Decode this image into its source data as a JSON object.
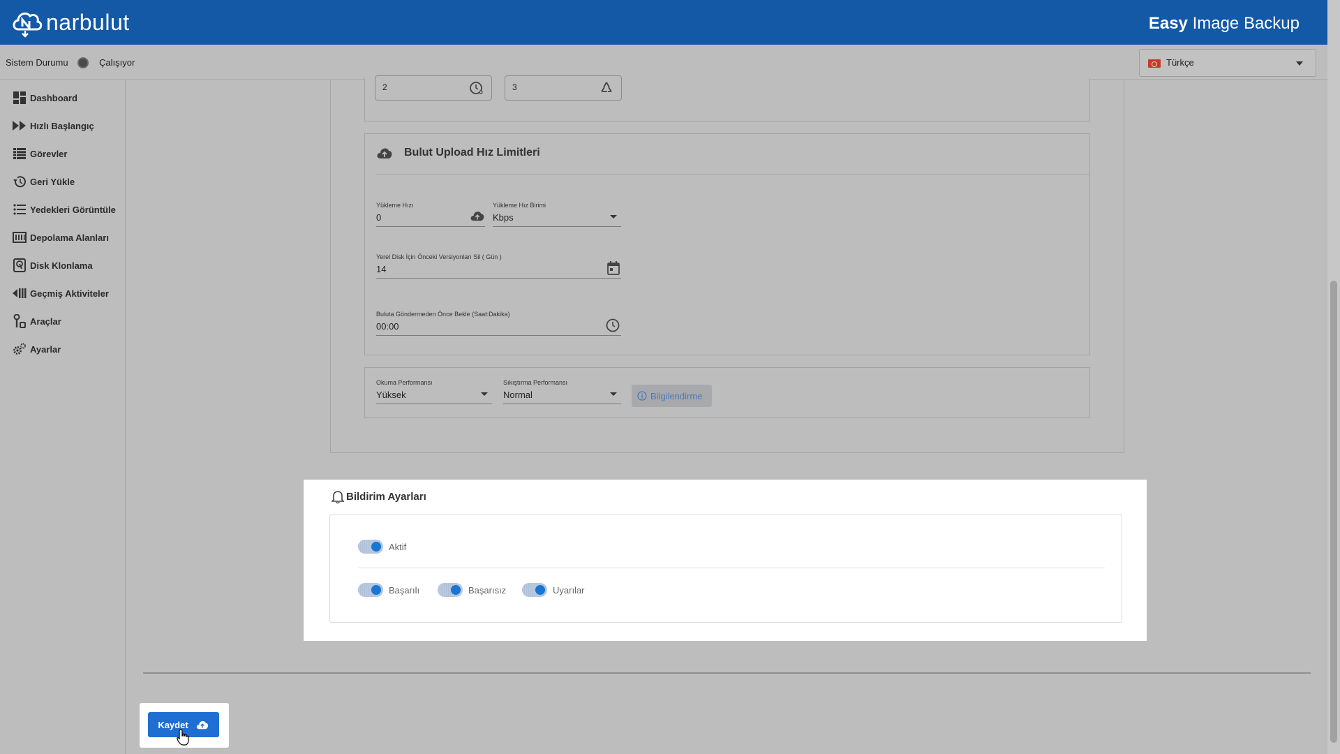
{
  "header": {
    "logo_text": "narbulut",
    "app_title_bold": "Easy",
    "app_title_rest": " Image Backup"
  },
  "status": {
    "label": "Sistem Durumu",
    "value": "Çalışıyor"
  },
  "language": {
    "selected": "Türkçe"
  },
  "sidebar": {
    "items": [
      {
        "label": "Dashboard",
        "icon": "dashboard-icon"
      },
      {
        "label": "Hızlı Başlangıç",
        "icon": "fast-forward-icon"
      },
      {
        "label": "Görevler",
        "icon": "list-icon"
      },
      {
        "label": "Geri Yükle",
        "icon": "restore-icon"
      },
      {
        "label": "Yedekleri Görüntüle",
        "icon": "view-list-icon"
      },
      {
        "label": "Depolama Alanları",
        "icon": "storage-icon"
      },
      {
        "label": "Disk Klonlama",
        "icon": "disk-clone-icon"
      },
      {
        "label": "Geçmiş Aktiviteler",
        "icon": "history-icon"
      },
      {
        "label": "Araçlar",
        "icon": "tools-icon"
      },
      {
        "label": "Ayarlar",
        "icon": "settings-icon"
      }
    ]
  },
  "top_fields": {
    "field1_value": "2",
    "field2_value": "3"
  },
  "upload_limits": {
    "title": "Bulut Upload Hız Limitleri",
    "speed_label": "Yükleme Hızı",
    "speed_value": "0",
    "unit_label": "Yükleme Hız Birimi",
    "unit_value": "Kbps",
    "delete_label": "Yerel Disk İçin Önceki Versiyonları Sil ( Gün )",
    "delete_value": "14",
    "wait_label": "Buluta Göndermeden Önce Bekle (Saat:Dakika)",
    "wait_value": "00:00"
  },
  "performance": {
    "read_label": "Okuma Performansı",
    "read_value": "Yüksek",
    "compress_label": "Sıkıştırma Performansı",
    "compress_value": "Normal",
    "info_button": "Bilgilendirme"
  },
  "notifications": {
    "title": "Bildirim Ayarları",
    "active_label": "Aktif",
    "success_label": "Başarılı",
    "fail_label": "Başarısız",
    "warnings_label": "Uyarılar",
    "active_on": true,
    "success_on": true,
    "fail_on": true,
    "warnings_on": true
  },
  "footer": {
    "save_label": "Kaydet"
  },
  "colors": {
    "header_bg": "#1359a6",
    "accent": "#1e6fd1",
    "toggle_on": "#1976d2"
  }
}
